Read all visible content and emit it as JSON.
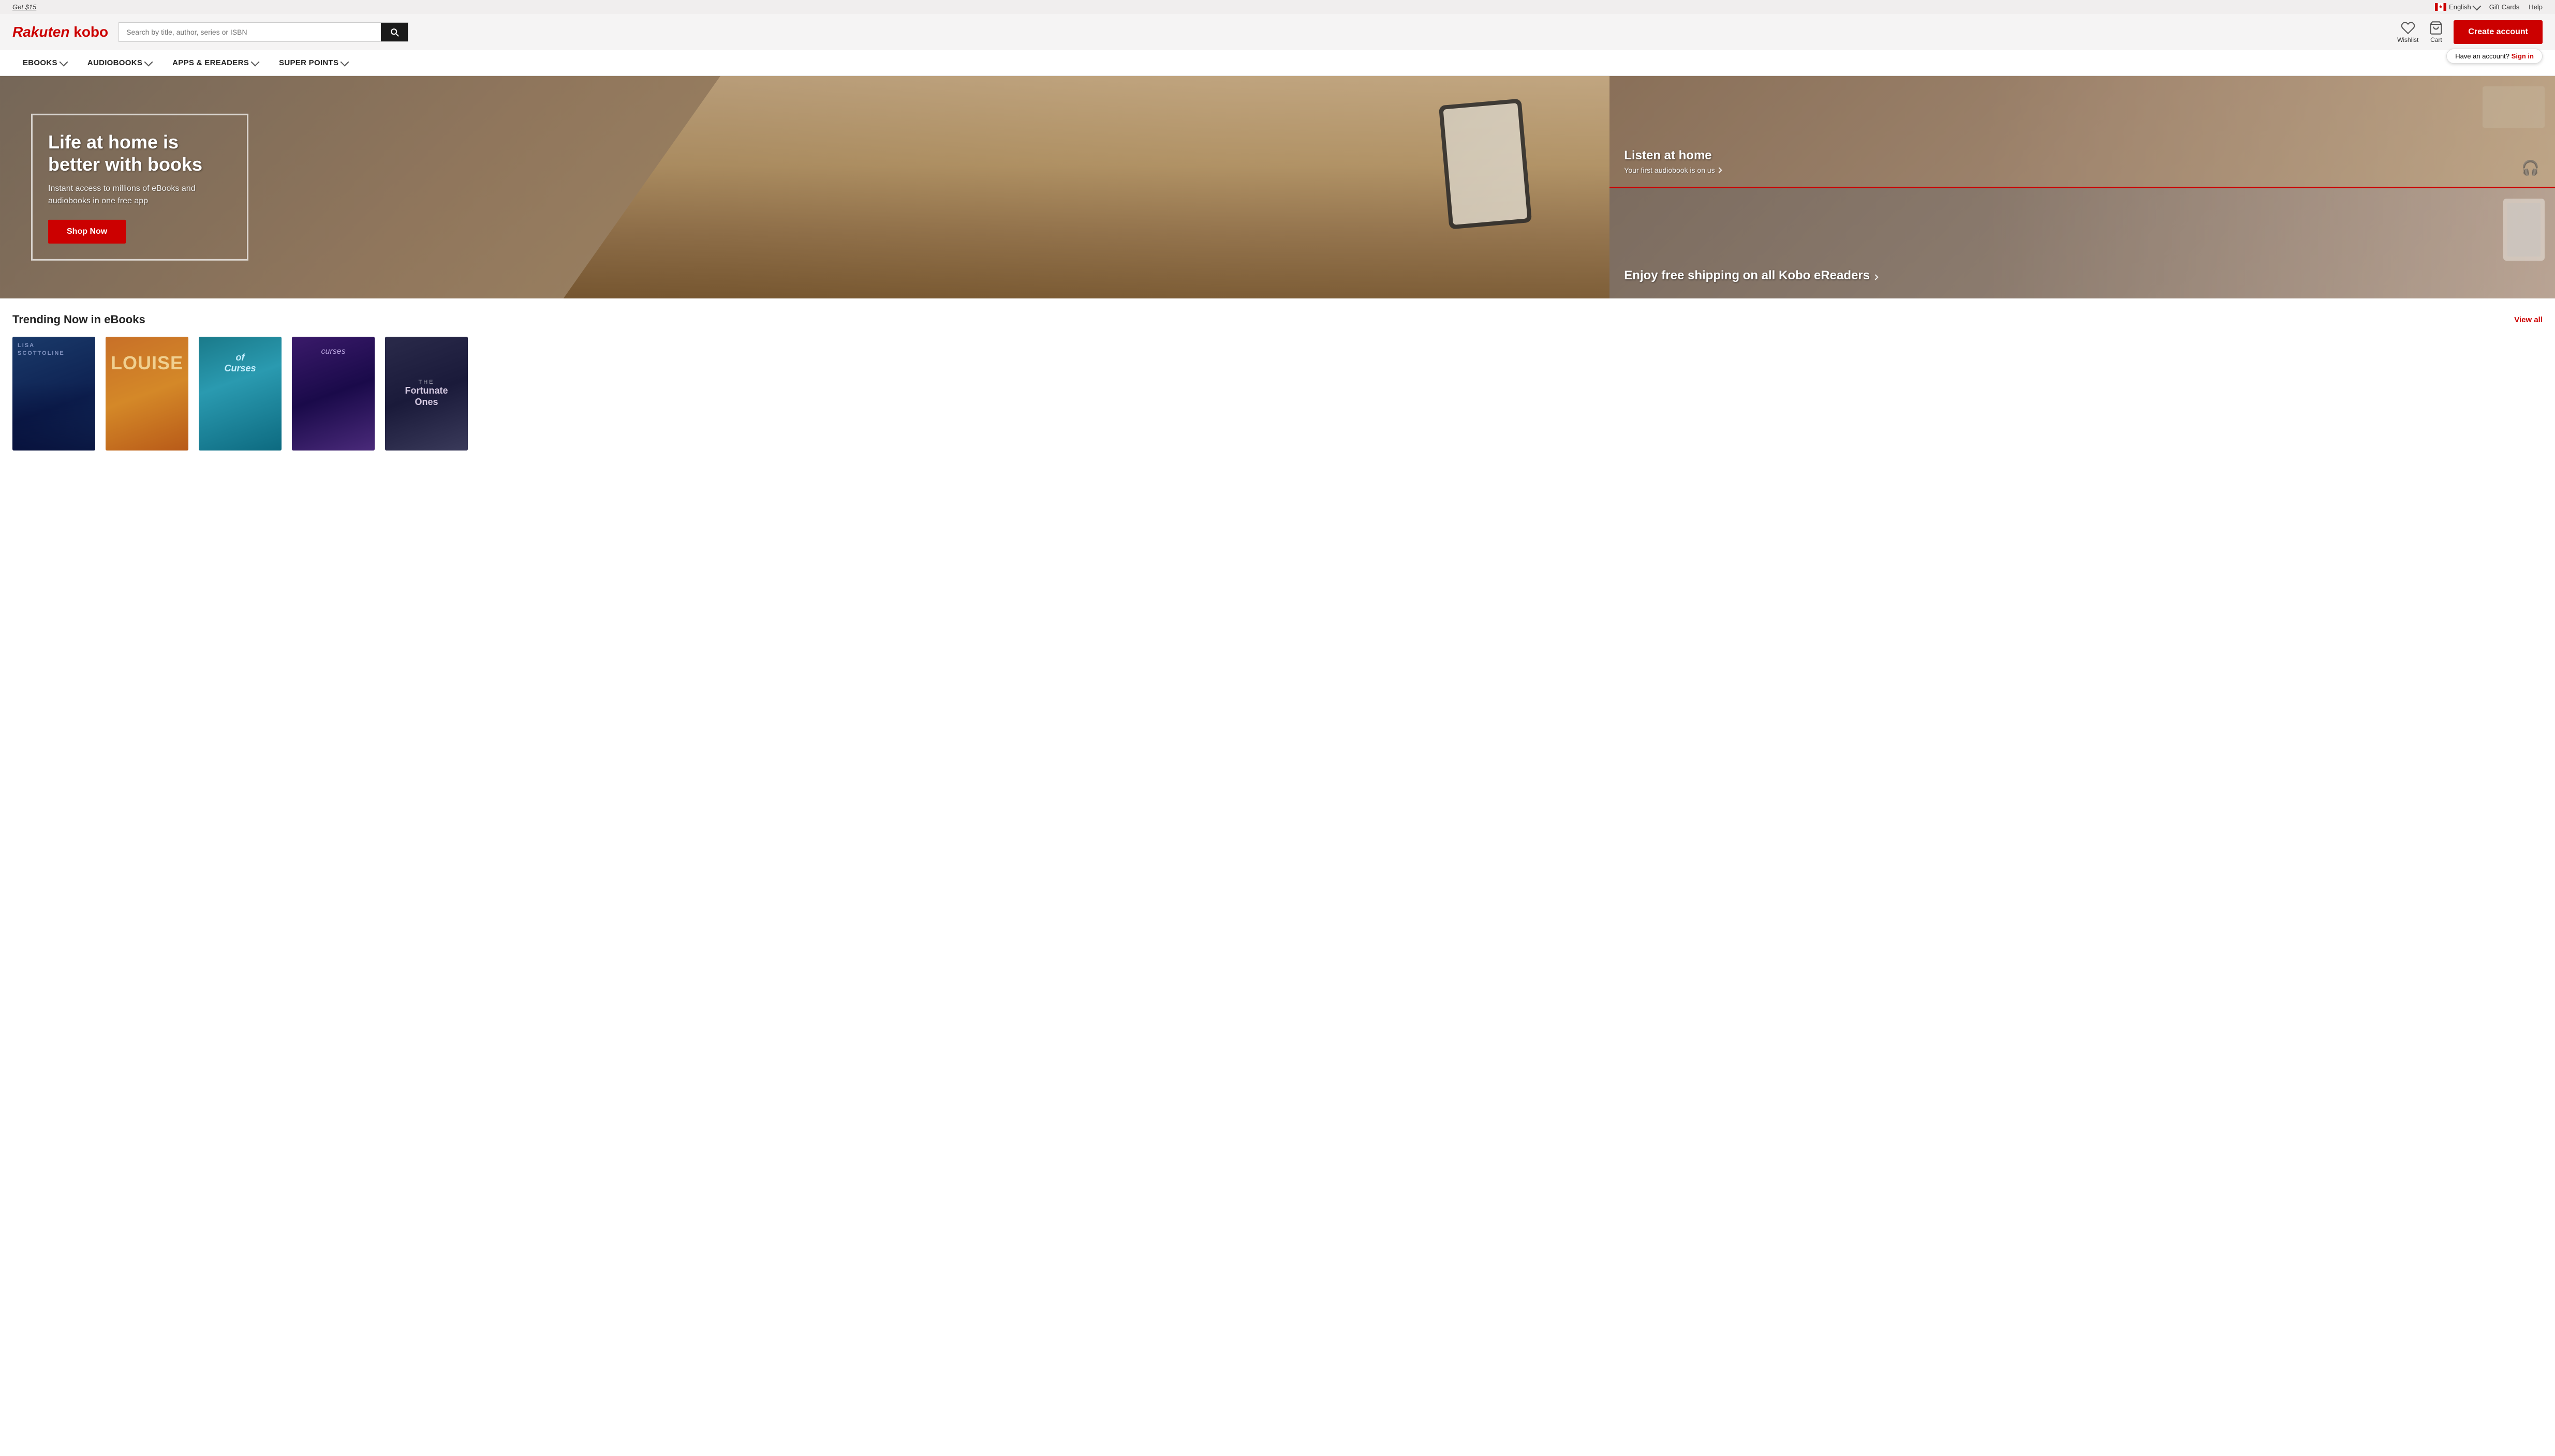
{
  "topbar": {
    "promo_link": "Get $15",
    "language": "English",
    "gift_cards": "Gift Cards",
    "help": "Help"
  },
  "header": {
    "logo_text": "Rakuten kobo",
    "search_placeholder": "Search by title, author, series or ISBN",
    "wishlist_label": "Wishlist",
    "cart_label": "Cart",
    "create_account_label": "Create account",
    "have_account_text": "Have an account?",
    "sign_in_label": "Sign in"
  },
  "nav": {
    "items": [
      {
        "label": "eBOOKS",
        "has_dropdown": true
      },
      {
        "label": "AUDIOBOOKS",
        "has_dropdown": true
      },
      {
        "label": "APPS & eREADERS",
        "has_dropdown": true
      },
      {
        "label": "SUPER POINTS",
        "has_dropdown": true
      }
    ]
  },
  "hero": {
    "main": {
      "title": "Life at home is better with books",
      "subtitle": "Instant access to millions of eBooks and audiobooks in one free app",
      "cta_label": "Shop Now"
    },
    "panel_top": {
      "title": "Listen at home",
      "subtitle": "Your first audiobook is on us"
    },
    "panel_bottom": {
      "title": "Enjoy free shipping on all Kobo eReaders",
      "subtitle": ""
    }
  },
  "trending": {
    "section_title": "Trending Now in eBooks",
    "view_all_label": "View all",
    "books": [
      {
        "author": "LISA SCOTTOLINE",
        "title": "",
        "color": "book-1"
      },
      {
        "author": "",
        "title": "LOUISE",
        "color": "book-2"
      },
      {
        "author": "",
        "title": "Of Curses",
        "color": "book-3"
      },
      {
        "author": "",
        "title": "Curses",
        "color": "book-4"
      },
      {
        "author": "",
        "title": "The Fortunate Ones",
        "color": "book-5"
      }
    ]
  },
  "icons": {
    "heart": "♡",
    "cart": "🛒",
    "search": "🔍",
    "chevron_down": "▾",
    "chevron_right": "›"
  },
  "colors": {
    "brand_red": "#cc0000",
    "dark": "#1a1a1a",
    "light_bg": "#f5f4f4",
    "top_bg": "#f0eeee"
  }
}
